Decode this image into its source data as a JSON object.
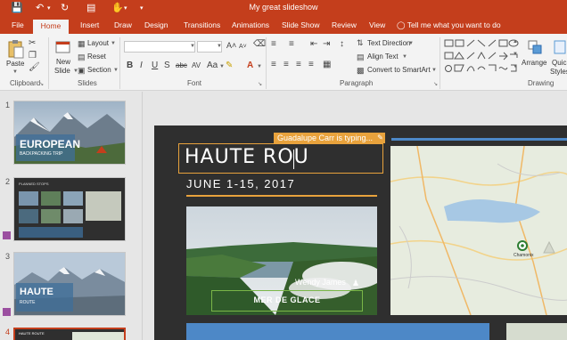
{
  "window": {
    "title": "My great slideshow"
  },
  "tabs": [
    {
      "label": "File"
    },
    {
      "label": "Home"
    },
    {
      "label": "Insert"
    },
    {
      "label": "Draw"
    },
    {
      "label": "Design"
    },
    {
      "label": "Transitions"
    },
    {
      "label": "Animations"
    },
    {
      "label": "Slide Show"
    },
    {
      "label": "Review"
    },
    {
      "label": "View"
    }
  ],
  "tell_me": "Tell me what you want to do",
  "ribbon": {
    "clipboard": {
      "paste": "Paste",
      "label": "Clipboard"
    },
    "slides": {
      "new_slide_1": "New",
      "new_slide_2": "Slide",
      "layout": "Layout",
      "reset": "Reset",
      "section": "Section",
      "label": "Slides"
    },
    "font": {
      "label": "Font",
      "change_case": "Aa"
    },
    "paragraph": {
      "text_direction": "Text Direction",
      "align_text": "Align Text",
      "convert": "Convert to SmartArt",
      "label": "Paragraph"
    },
    "drawing": {
      "arrange": "Arrange",
      "quick_1": "Quick",
      "quick_2": "Styles",
      "label": "Drawing"
    }
  },
  "thumbnails": [
    {
      "number": "1",
      "title": "EUROPEAN",
      "subtitle": "BACKPACKING TRIP"
    },
    {
      "number": "2",
      "title": "PLANNED STOPS"
    },
    {
      "number": "3",
      "title": "HAUTE",
      "subtitle": "ROUTE"
    },
    {
      "number": "4",
      "title": "HAUTE ROUTE"
    }
  ],
  "slide": {
    "title": "HAUTE ROU",
    "date": "JUNE 1-15, 2017",
    "coauthor_flag": "Guadalupe Carr is typing...",
    "photo_author": "Wendy James",
    "photo_caption": "MER DE GLACE",
    "map_label": "Chamonix"
  },
  "colors": {
    "accent": "#c43e1c",
    "highlight": "#e8a23c",
    "presence_green": "#7ab648",
    "slide_bg": "#2f2f2f"
  }
}
